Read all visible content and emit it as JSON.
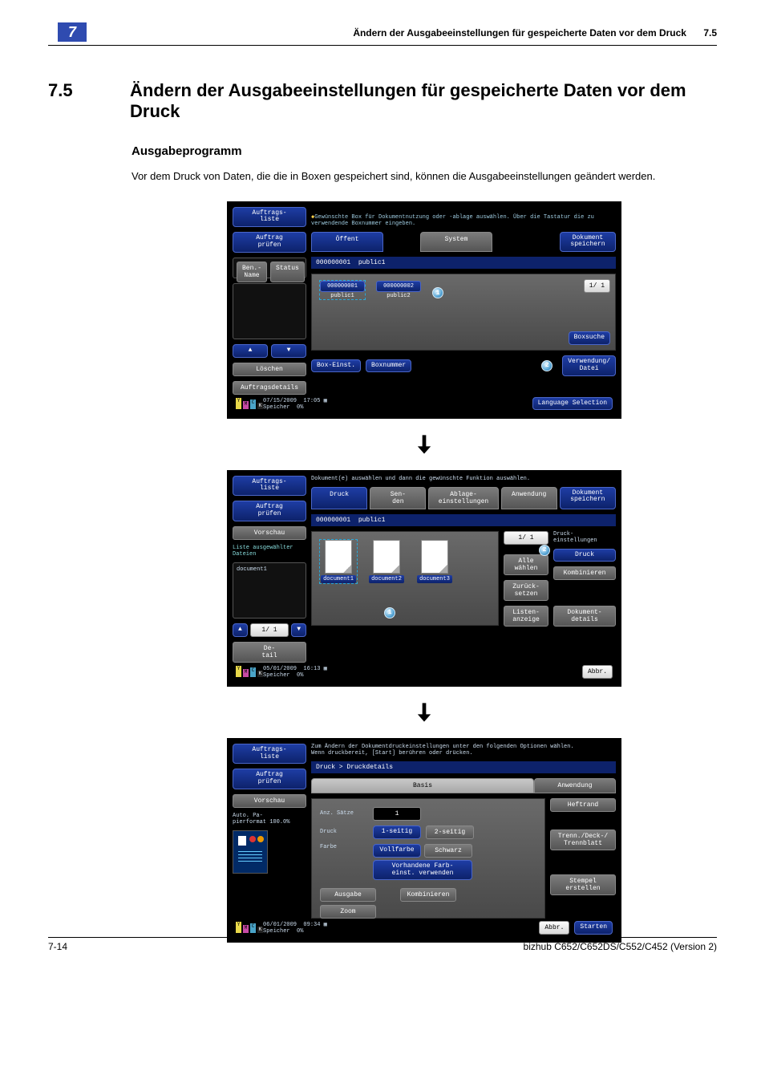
{
  "page_header": {
    "chapter_number": "7",
    "running_title": "Ändern der Ausgabeeinstellungen für gespeicherte Daten vor dem Druck",
    "running_secnum": "7.5"
  },
  "section": {
    "number": "7.5",
    "title": "Ändern der Ausgabeeinstellungen für gespeicherte Daten vor dem Druck"
  },
  "subsection": {
    "title": "Ausgabeprogramm"
  },
  "paragraph": "Vor dem Druck von Daten, die die in Boxen gespeichert sind, können die Ausgabeeinstellungen geändert werden.",
  "shot1": {
    "hint": "Gewünschte Box für Dokumentnutzung oder -ablage auswählen. Über die Tastatur die zu verwendende Boxnummer eingeben.",
    "left": {
      "auftragsliste": "Auftrags-\nliste",
      "auftrag_pruefen": "Auftrag\nprüfen",
      "col_ben": "Ben.-\nName",
      "col_status": "Status",
      "loeschen": "Löschen",
      "auftragsdetails": "Auftragsdetails"
    },
    "tabs": {
      "offent": "Öffent",
      "system": "System",
      "dokument_speichern": "Dokument\nspeichern"
    },
    "strip": {
      "boxnum": "000000001",
      "boxname": "public1"
    },
    "boxes": [
      {
        "num": "000000001",
        "name": "public1"
      },
      {
        "num": "000000002",
        "name": "public2"
      }
    ],
    "pager": "1/ 1",
    "boxsuche": "Boxsuche",
    "bottom": {
      "boxeinst": "Box-Einst.",
      "boxnummer": "Boxnummer",
      "verwendung": "Verwendung/\nDatei"
    },
    "footer": {
      "date": "07/15/2009",
      "time": "17:05",
      "mem_lbl": "Speicher",
      "mem_val": "0%",
      "lang": "Language Selection"
    },
    "callouts": {
      "c1": "1",
      "c2": "2"
    }
  },
  "shot2": {
    "hint": "Dokument(e) auswählen und dann die gewünschte Funktion auswählen.",
    "left": {
      "auftragsliste": "Auftrags-\nliste",
      "auftrag_pruefen": "Auftrag\nprüfen",
      "vorschau": "Vorschau",
      "liste_hdr": "Liste ausgewählter\nDateien",
      "doc": "document1",
      "pager": "1/ 1",
      "detail": "De-\ntail"
    },
    "tabs": {
      "druck": "Druck",
      "senden": "Sen-\nden",
      "ablage": "Ablage-\neinstellungen",
      "anwendung": "Anwendung",
      "dokument_speichern": "Dokument\nspeichern"
    },
    "strip": {
      "boxnum": "000000001",
      "boxname": "public1"
    },
    "docs": [
      "document1",
      "document2",
      "document3"
    ],
    "right": {
      "pager": "1/ 1",
      "druckeinst": "Druck-\neinstellungen",
      "druck": "Druck",
      "kombinieren": "Kombinieren",
      "alle": "Alle\nwählen",
      "zurueck": "Zurück-\nsetzen",
      "liste": "Listen-\nanzeige",
      "dokdetails": "Dokument-\ndetails"
    },
    "footer": {
      "date": "05/01/2009",
      "time": "16:13",
      "mem_lbl": "Speicher",
      "mem_val": "0%",
      "abbr": "Abbr."
    },
    "callouts": {
      "c1": "1",
      "c2": "2"
    }
  },
  "shot3": {
    "hint": "Zum Ändern der Dokumentdruckeinstellungen unter den folgenden Optionen wählen.\nWenn druckbereit, [Start] berühren oder drücken.",
    "left": {
      "auftragsliste": "Auftrags-\nliste",
      "auftrag_pruefen": "Auftrag\nprüfen",
      "vorschau": "Vorschau",
      "autopapier_lbl": "Auto. Pa-\npierformat",
      "autopapier_val": "100.0%"
    },
    "breadcrumb": "Druck > Druckdetails",
    "tabs": {
      "basis": "Basis",
      "anwendung": "Anwendung"
    },
    "rows": {
      "anz_satz_lbl": "Anz. Sätze",
      "anz_satz_val": "1",
      "druck_lbl": "Druck",
      "einseitig": "1-seitig",
      "zweiseitig": "2-seitig",
      "farbe_lbl": "Farbe",
      "vollfarbe": "Vollfarbe",
      "schwarz": "Schwarz",
      "vorhandene": "Vorhandene Farb-\neinst. verwenden",
      "ausgabe": "Ausgabe",
      "kombinieren": "Kombinieren",
      "zoom": "Zoom"
    },
    "right": {
      "heftrand": "Heftrand",
      "trenn": "Trenn./Deck-/\nTrennblatt",
      "stempel": "Stempel\nerstellen"
    },
    "footer": {
      "date": "06/01/2009",
      "time": "09:34",
      "mem_lbl": "Speicher",
      "mem_val": "0%",
      "abbr": "Abbr.",
      "starten": "Starten"
    }
  },
  "page_footer": {
    "left": "7-14",
    "right": "bizhub C652/C652DS/C552/C452 (Version 2)"
  }
}
